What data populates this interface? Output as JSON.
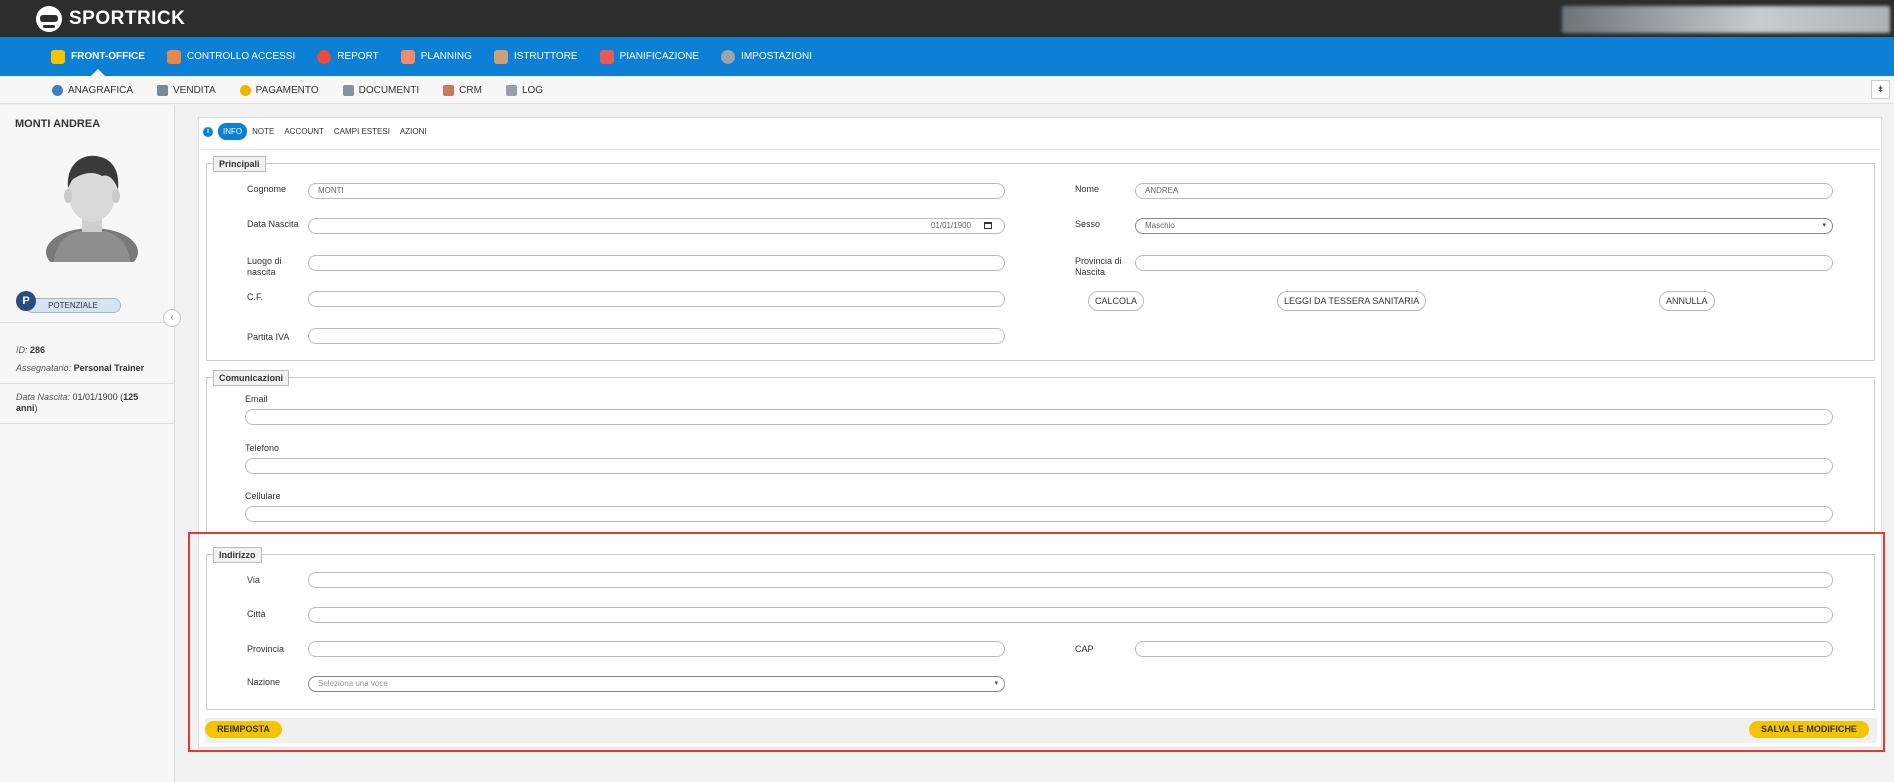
{
  "app": {
    "name": "SPORTRICK"
  },
  "main_nav": [
    {
      "label": "FRONT-OFFICE",
      "icon": "front-office-icon",
      "color": "#f5c400"
    },
    {
      "label": "CONTROLLO ACCESSI",
      "icon": "access-control-icon",
      "color": "#e8874a"
    },
    {
      "label": "REPORT",
      "icon": "report-icon",
      "color": "#e94b3c"
    },
    {
      "label": "PLANNING",
      "icon": "planning-icon",
      "color": "#f08a6a"
    },
    {
      "label": "ISTRUTTORE",
      "icon": "instructor-icon",
      "color": "#c9a07a"
    },
    {
      "label": "PIANIFICAZIONE",
      "icon": "calendar-icon",
      "color": "#e65a5a"
    },
    {
      "label": "IMPOSTAZIONI",
      "icon": "settings-icon",
      "color": "#9aa4ad"
    }
  ],
  "sub_nav": [
    {
      "label": "ANAGRAFICA",
      "icon": "person-icon",
      "color": "#3b82c4"
    },
    {
      "label": "VENDITA",
      "icon": "sale-icon",
      "color": "#7a8a99"
    },
    {
      "label": "PAGAMENTO",
      "icon": "payment-icon",
      "color": "#f0b400"
    },
    {
      "label": "DOCUMENTI",
      "icon": "document-icon",
      "color": "#8a9099"
    },
    {
      "label": "CRM",
      "icon": "crm-icon",
      "color": "#c87a5a"
    },
    {
      "label": "LOG",
      "icon": "log-icon",
      "color": "#9aa0a6"
    }
  ],
  "pin_label": "⇟",
  "sidebar": {
    "name": "MONTI ANDREA",
    "badge": "P",
    "status": "POTENZIALE",
    "id_label": "ID:",
    "id_value": "286",
    "assignee_label": "Assegnatario:",
    "assignee_value": "Personal Trainer",
    "birth_label": "Data Nascita:",
    "birth_value": "01/01/1900 (",
    "age_value": "125 anni",
    "birth_close": ")",
    "collapse": "‹"
  },
  "tabs": [
    {
      "label": "INFO",
      "active": true
    },
    {
      "label": "NOTE"
    },
    {
      "label": "ACCOUNT"
    },
    {
      "label": "CAMPI ESTESI"
    },
    {
      "label": "AZIONI"
    }
  ],
  "principali": {
    "legend": "Principali",
    "cognome_label": "Cognome",
    "cognome_value": "MONTI",
    "nome_label": "Nome",
    "nome_value": "ANDREA",
    "data_nascita_label": "Data Nascita",
    "data_nascita_value": "01/01/1900",
    "sesso_label": "Sesso",
    "sesso_value": "Maschio",
    "luogo_label": "Luogo di nascita",
    "luogo_value": "",
    "provincia_label": "Provincia di Nascita",
    "provincia_value": "",
    "cf_label": "C.F.",
    "cf_value": "",
    "piva_label": "Partita IVA",
    "piva_value": "",
    "calcola": "CALCOLA",
    "leggi": "LEGGI DA TESSERA SANITARIA",
    "annulla": "ANNULLA"
  },
  "comunicazioni": {
    "legend": "Comunicazioni",
    "email_label": "Email",
    "telefono_label": "Telefono",
    "cellulare_label": "Cellulare"
  },
  "indirizzo": {
    "legend": "Indirizzo",
    "via_label": "Via",
    "citta_label": "Città",
    "provincia_label": "Provincia",
    "cap_label": "CAP",
    "nazione_label": "Nazione",
    "nazione_placeholder": "Seleziona una voce"
  },
  "footer": {
    "reset": "REIMPOSTA",
    "save": "SALVA LE MODIFICHE"
  }
}
